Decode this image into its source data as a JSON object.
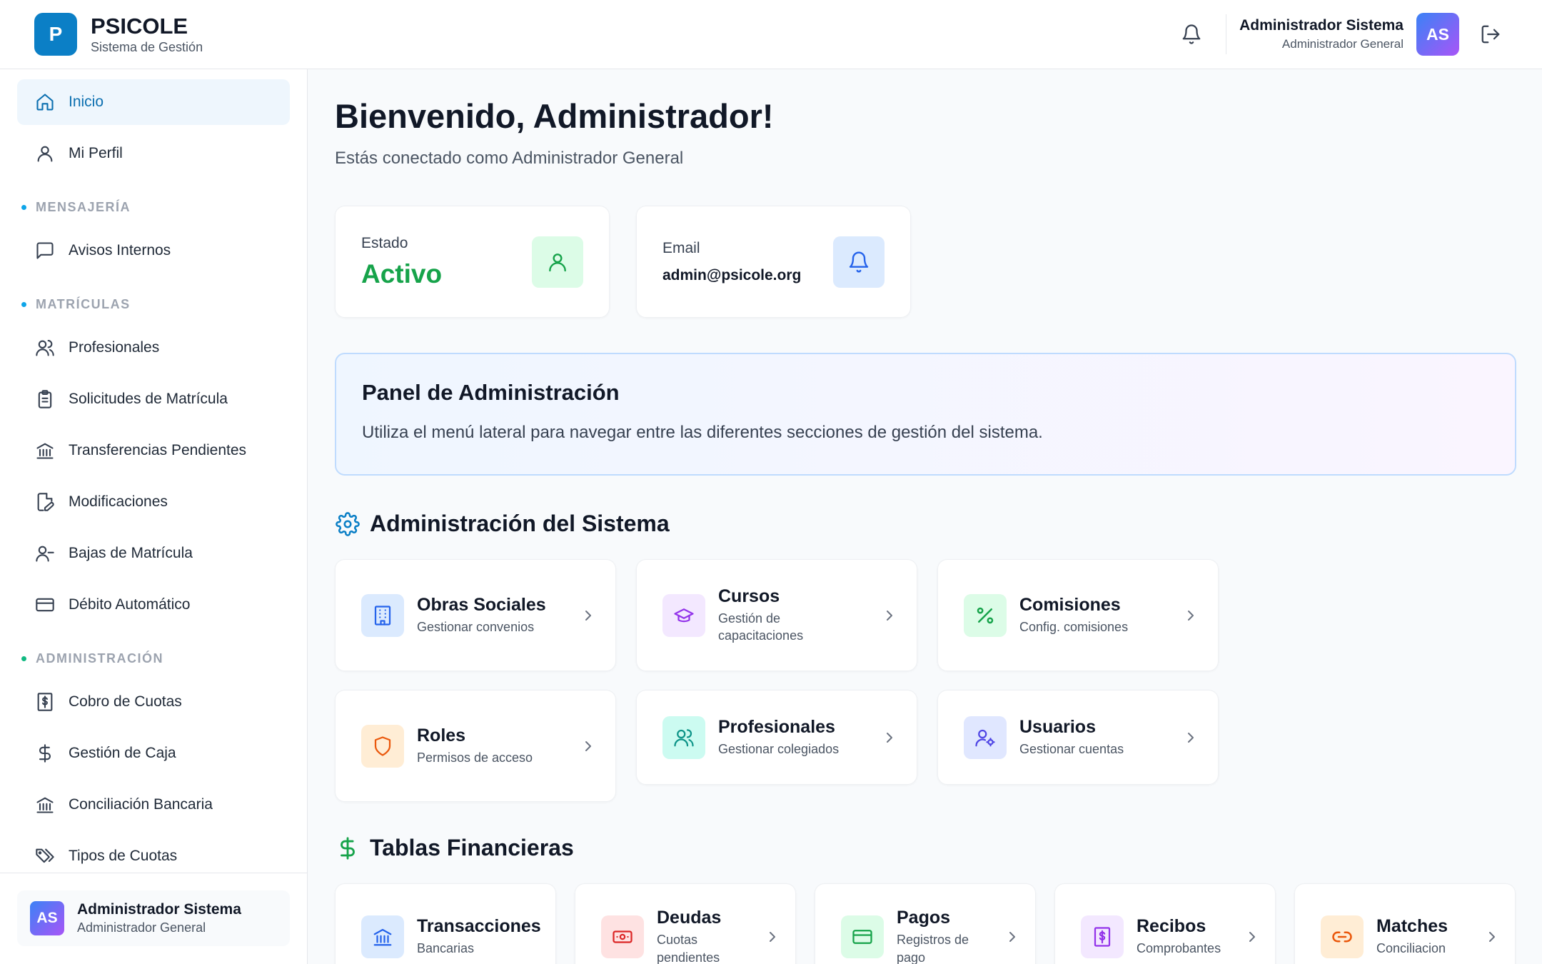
{
  "header": {
    "logo_letter": "P",
    "brand_title": "PSICOLE",
    "brand_subtitle": "Sistema de Gestión",
    "user_name": "Administrador Sistema",
    "user_role": "Administrador General",
    "user_initials": "AS"
  },
  "sidebar": {
    "items_top": [
      {
        "label": "Inicio",
        "icon": "home-icon",
        "active": true
      },
      {
        "label": "Mi Perfil",
        "icon": "user-icon"
      }
    ],
    "sections": [
      {
        "title": "MENSAJERÍA",
        "dot_color": "#0ea5e9",
        "items": [
          {
            "label": "Avisos Internos",
            "icon": "message-icon"
          }
        ]
      },
      {
        "title": "MATRÍCULAS",
        "dot_color": "#0ea5e9",
        "items": [
          {
            "label": "Profesionales",
            "icon": "users-icon"
          },
          {
            "label": "Solicitudes de Matrícula",
            "icon": "clipboard-icon"
          },
          {
            "label": "Transferencias Pendientes",
            "icon": "bank-icon"
          },
          {
            "label": "Modificaciones",
            "icon": "file-edit-icon"
          },
          {
            "label": "Bajas de Matrícula",
            "icon": "user-minus-icon"
          },
          {
            "label": "Débito Automático",
            "icon": "credit-card-icon"
          }
        ]
      },
      {
        "title": "ADMINISTRACIÓN",
        "dot_color": "#10b981",
        "items": [
          {
            "label": "Cobro de Cuotas",
            "icon": "receipt-dollar-icon"
          },
          {
            "label": "Gestión de Caja",
            "icon": "dollar-icon"
          },
          {
            "label": "Conciliación Bancaria",
            "icon": "bank-icon"
          },
          {
            "label": "Tipos de Cuotas",
            "icon": "tags-icon"
          }
        ]
      }
    ],
    "footer_user": {
      "initials": "AS",
      "name": "Administrador Sistema",
      "role": "Administrador General"
    }
  },
  "main": {
    "welcome_title": "Bienvenido, Administrador!",
    "welcome_subtitle": "Estás conectado como Administrador General",
    "stats": {
      "estado_label": "Estado",
      "estado_value": "Activo",
      "email_label": "Email",
      "email_value": "admin@psicole.org"
    },
    "panel": {
      "title": "Panel de Administración",
      "text": "Utiliza el menú lateral para navegar entre las diferentes secciones de gestión del sistema."
    },
    "admin_section": {
      "title": "Administración del Sistema",
      "cards": [
        {
          "title": "Obras Sociales",
          "subtitle": "Gestionar convenios",
          "icon": "building-icon",
          "bg": "#dbeafe",
          "fg": "#2563eb"
        },
        {
          "title": "Cursos",
          "subtitle": "Gestión de capacitaciones",
          "icon": "graduation-cap-icon",
          "bg": "#f3e8ff",
          "fg": "#9333ea"
        },
        {
          "title": "Comisiones",
          "subtitle": "Config. comisiones",
          "icon": "percent-icon",
          "bg": "#dcfce7",
          "fg": "#16a34a"
        },
        {
          "title": "Roles",
          "subtitle": "Permisos de acceso",
          "icon": "shield-icon",
          "bg": "#ffedd5",
          "fg": "#ea580c"
        },
        {
          "title": "Profesionales",
          "subtitle": "Gestionar colegiados",
          "icon": "users-icon",
          "bg": "#ccfbf1",
          "fg": "#0d9488"
        },
        {
          "title": "Usuarios",
          "subtitle": "Gestionar cuentas",
          "icon": "user-cog-icon",
          "bg": "#e0e7ff",
          "fg": "#4f46e5"
        }
      ]
    },
    "fin_section": {
      "title": "Tablas Financieras",
      "cards": [
        {
          "title": "Transacciones",
          "subtitle": "Bancarias",
          "icon": "bank-icon",
          "bg": "#dbeafe",
          "fg": "#2563eb"
        },
        {
          "title": "Deudas",
          "subtitle": "Cuotas pendientes",
          "icon": "banknote-icon",
          "bg": "#fee2e2",
          "fg": "#dc2626"
        },
        {
          "title": "Pagos",
          "subtitle": "Registros de pago",
          "icon": "credit-card-icon",
          "bg": "#dcfce7",
          "fg": "#16a34a"
        },
        {
          "title": "Recibos",
          "subtitle": "Comprobantes",
          "icon": "receipt-dollar-icon",
          "bg": "#f3e8ff",
          "fg": "#9333ea"
        },
        {
          "title": "Matches",
          "subtitle": "Conciliacion",
          "icon": "link-icon",
          "bg": "#ffedd5",
          "fg": "#ea580c"
        }
      ]
    }
  }
}
